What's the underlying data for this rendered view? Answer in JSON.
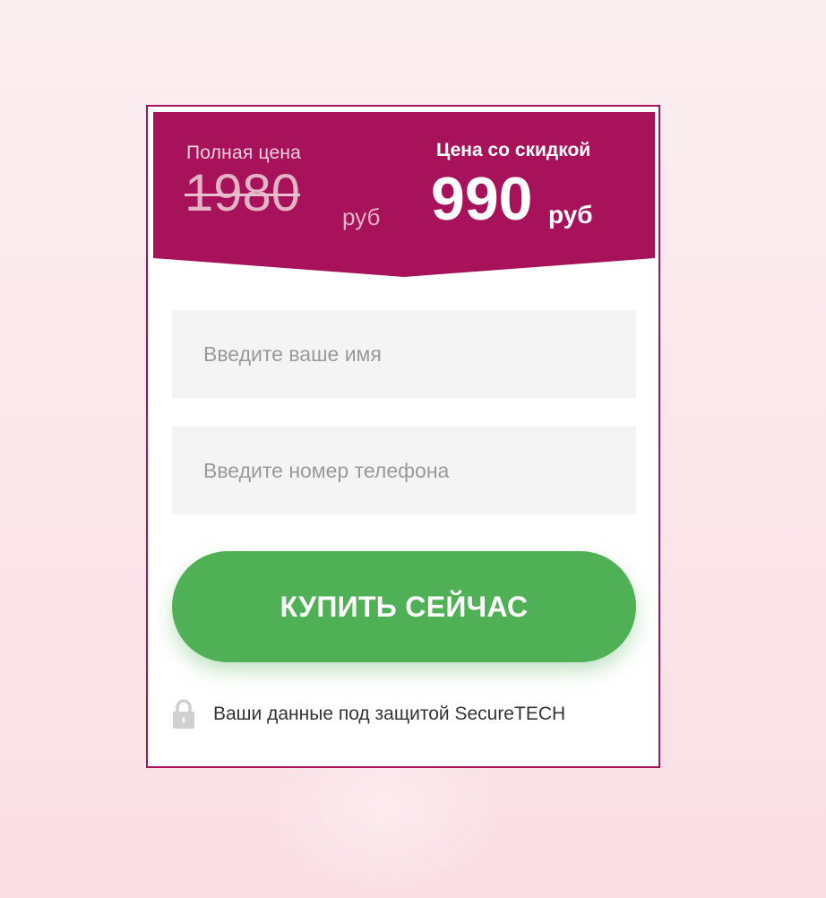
{
  "offer": {
    "old_price_label": "Полная цена",
    "old_price_value": "1980",
    "old_price_currency": "руб",
    "new_price_label": "Цена со скидкой",
    "new_price_value": "990",
    "new_price_currency": "руб"
  },
  "form": {
    "name_placeholder": "Введите ваше имя",
    "phone_placeholder": "Введите номер телефона",
    "submit_label": "КУПИТЬ СЕЙЧАС"
  },
  "security": {
    "icon": "lock-icon",
    "text": "Ваши данные под защитой SecureTECH"
  },
  "colors": {
    "banner": "#a8125a",
    "button": "#4fb055",
    "input_background": "#f4f4f4",
    "page_background": "#fbe6ea"
  }
}
